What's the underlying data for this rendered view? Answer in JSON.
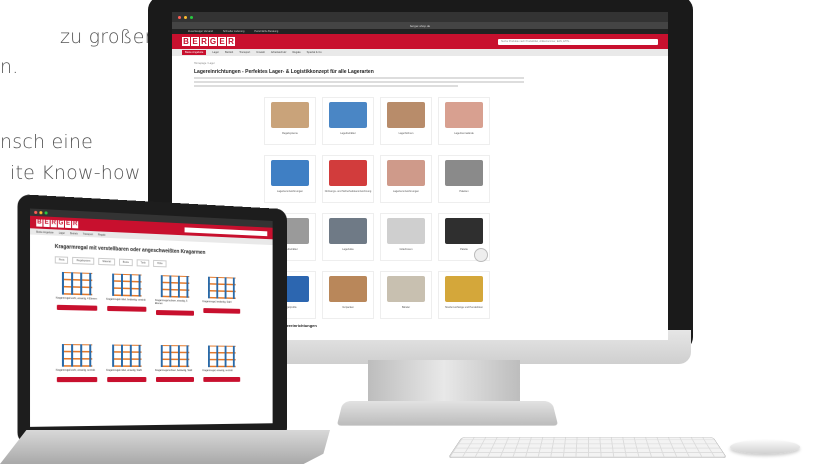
{
  "background_text": [
    "zu großen,",
    "n.",
    "nsch eine",
    "ite Know-how"
  ],
  "monitor": {
    "url": "berger-shop.de",
    "top_links": [
      "Zuverlässiger Versand",
      "Schneller Lieferung",
      "Persönliche Beratung"
    ],
    "logo_letters": [
      "B",
      "E",
      "R",
      "G",
      "E",
      "R"
    ],
    "search_placeholder": "Suche Produkte nach Produkttitel, Artikelnummer, EAN, ETIN...",
    "nav": [
      "Beste Angebote",
      "Lager",
      "Betrieb",
      "Transport",
      "Umwelt",
      "Arbeitsschutz",
      "Regale",
      "Spezial & Co"
    ],
    "breadcrumb": "Homepage  /  Lager",
    "heading": "Lagereinrichtungen - Perfektes Lager- & Logistikkonzept für alle Lagerarten",
    "categories": [
      {
        "label": "Regalsysteme",
        "color": "#c9a37a"
      },
      {
        "label": "Lagerbehälter",
        "color": "#4a86c5"
      },
      {
        "label": "Lagerbühnen",
        "color": "#b88c6a"
      },
      {
        "label": "Lagertrennwände",
        "color": "#d8a090"
      },
      {
        "label": "Lagerkennzeichnungen",
        "color": "#3f7fc4"
      },
      {
        "label": "Ordnungs- und Sicherheitskennzeichnung",
        "color": "#d23c3c"
      },
      {
        "label": "Lagerkennzeichnungen",
        "color": "#cf9a8a"
      },
      {
        "label": "Paletten",
        "color": "#8a8a8a"
      },
      {
        "label": "Lagerbehälter",
        "color": "#9a9a9a"
      },
      {
        "label": "Lagerkiste",
        "color": "#6f7a86"
      },
      {
        "label": "Gitterboxen",
        "color": "#cfcfcf"
      },
      {
        "label": "Palette",
        "color": "#2f2f2f"
      },
      {
        "label": "Regalprofile",
        "color": "#2c66b0"
      },
      {
        "label": "Verpacken",
        "color": "#b9875a"
      },
      {
        "label": "Bänder",
        "color": "#c8c0b0"
      },
      {
        "label": "Streifenvorhänge und Pendeltüren",
        "color": "#d4a73a"
      }
    ],
    "more_heading": "Weitere Lagereinrichtungen"
  },
  "laptop": {
    "heading": "Kragarmregal mit verstellbaren oder angeschweißten Kragarmen",
    "filters": [
      "Preis",
      "Regalsystem",
      "Material",
      "Breite",
      "Tiefe",
      "Höhe"
    ],
    "products": [
      "Kragarmregal leicht, einseitig, 4 Ebenen",
      "Kragarmregal mittel, beidseitig, verzinkt",
      "Kragarmregal schwer, einseitig, 5 Ebenen",
      "Kragarmregal, beidseitig, Stahl",
      "Kragarmregal leicht, einseitig, verzinkt",
      "Kragarmregal mittel, einseitig, Stahl",
      "Kragarmregal schwer, beidseitig, Stahl",
      "Kragarmregal, einseitig, verzinkt"
    ]
  }
}
